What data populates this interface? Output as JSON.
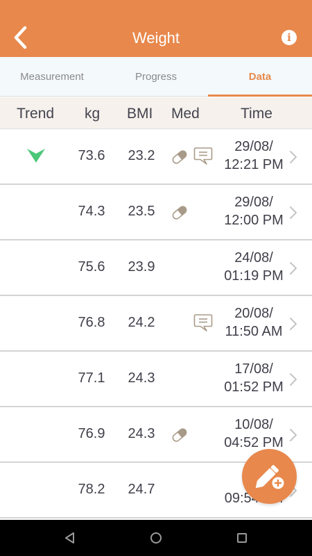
{
  "app_bar": {
    "title": "Weight",
    "back_icon": "chevron-left-icon",
    "info_icon": "info-icon",
    "info_glyph": "i",
    "color": "#e8884c"
  },
  "tabs": [
    {
      "label": "Measurement",
      "active": false
    },
    {
      "label": "Progress",
      "active": false
    },
    {
      "label": "Data",
      "active": true
    }
  ],
  "columns": {
    "trend": "Trend",
    "kg": "kg",
    "bmi": "BMI",
    "med": "Med",
    "time": "Time"
  },
  "rows": [
    {
      "trend": "down",
      "kg": "73.6",
      "bmi": "23.2",
      "med": true,
      "note": true,
      "date": "29/08/",
      "time": "12:21 PM"
    },
    {
      "trend": "",
      "kg": "74.3",
      "bmi": "23.5",
      "med": true,
      "note": false,
      "date": "29/08/",
      "time": "12:00 PM"
    },
    {
      "trend": "",
      "kg": "75.6",
      "bmi": "23.9",
      "med": false,
      "note": false,
      "date": "24/08/",
      "time": "01:19 PM"
    },
    {
      "trend": "",
      "kg": "76.8",
      "bmi": "24.2",
      "med": false,
      "note": true,
      "date": "20/08/",
      "time": "11:50 AM"
    },
    {
      "trend": "",
      "kg": "77.1",
      "bmi": "24.3",
      "med": false,
      "note": false,
      "date": "17/08/",
      "time": "01:52 PM"
    },
    {
      "trend": "",
      "kg": "76.9",
      "bmi": "24.3",
      "med": true,
      "note": false,
      "date": "10/08/",
      "time": "04:52 PM"
    },
    {
      "trend": "",
      "kg": "78.2",
      "bmi": "24.7",
      "med": false,
      "note": false,
      "date": "01",
      "time": "09:54 AM"
    }
  ],
  "fab": {
    "icon": "add-entry-pencil-icon"
  },
  "nav_bar": {
    "icons": [
      "back-triangle-icon",
      "home-circle-icon",
      "recents-square-icon"
    ]
  },
  "colors": {
    "accent": "#e8884c",
    "trend_down": "#4cc779",
    "icon_muted": "#a89a88"
  }
}
